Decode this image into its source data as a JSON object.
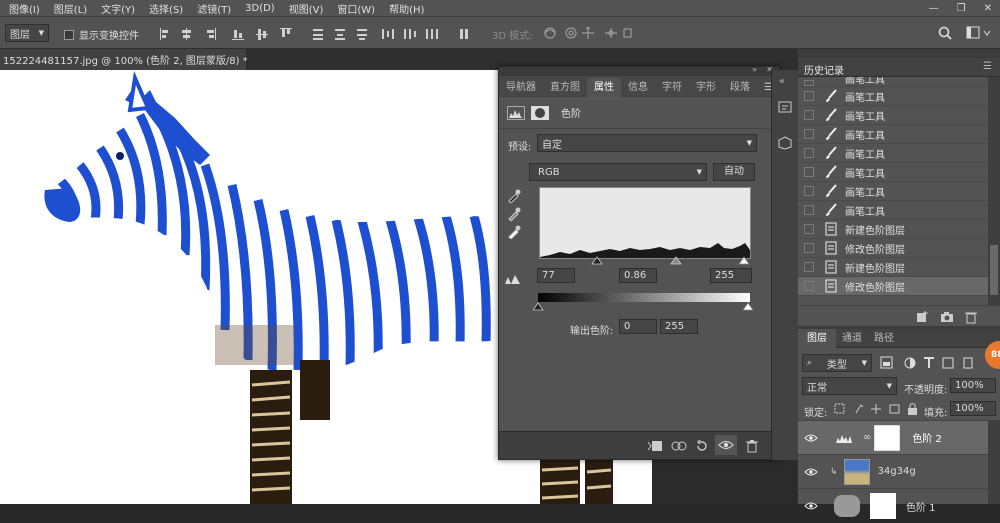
{
  "menubar": {
    "items": [
      "图像(I)",
      "图层(L)",
      "文字(Y)",
      "选择(S)",
      "滤镜(T)",
      "3D(D)",
      "视图(V)",
      "窗口(W)",
      "帮助(H)"
    ]
  },
  "options_bar": {
    "tool_select": "图层",
    "show_transform_label": "显示变换控件",
    "mode_3d_label": "3D 模式:"
  },
  "document": {
    "tab_title": "152224481157.jpg @ 100% (色阶 2, 图层蒙版/8) *",
    "close": "×"
  },
  "properties": {
    "tabs": [
      "导航器",
      "直方图",
      "属性",
      "信息",
      "字符",
      "字形",
      "段落"
    ],
    "active_tab": "属性",
    "layer_type": "色阶",
    "preset_label": "预设:",
    "preset_value": "自定",
    "channel_value": "RGB",
    "auto_button": "自动",
    "input_black": "77",
    "input_gamma": "0.86",
    "input_white": "255",
    "output_label": "输出色阶:",
    "output_black": "0",
    "output_white": "255"
  },
  "history": {
    "title": "历史记录",
    "items": [
      {
        "label": "画笔工具",
        "icon": "brush-icon"
      },
      {
        "label": "画笔工具",
        "icon": "brush-icon"
      },
      {
        "label": "画笔工具",
        "icon": "brush-icon"
      },
      {
        "label": "画笔工具",
        "icon": "brush-icon"
      },
      {
        "label": "画笔工具",
        "icon": "brush-icon"
      },
      {
        "label": "画笔工具",
        "icon": "brush-icon"
      },
      {
        "label": "画笔工具",
        "icon": "brush-icon"
      },
      {
        "label": "画笔工具",
        "icon": "brush-icon"
      },
      {
        "label": "新建色阶图层",
        "icon": "document-icon"
      },
      {
        "label": "修改色阶图层",
        "icon": "document-icon"
      },
      {
        "label": "新建色阶图层",
        "icon": "document-icon"
      },
      {
        "label": "修改色阶图层",
        "icon": "document-icon"
      }
    ]
  },
  "layers": {
    "tabs": [
      "图层",
      "通道",
      "路径"
    ],
    "filter_kind": "类型",
    "blend_mode": "正常",
    "opacity_label": "不透明度:",
    "opacity_value": "100%",
    "lock_label": "锁定:",
    "fill_label": "填充:",
    "fill_value": "100%",
    "rows": [
      {
        "name": "色阶 2"
      },
      {
        "name": "34g34g"
      },
      {
        "name": "色阶 1"
      }
    ],
    "badge": "88"
  },
  "colors": {
    "zebra_blue": "#1f4fd1",
    "accent_orange": "#e8782a",
    "panel_bg": "#535353"
  }
}
